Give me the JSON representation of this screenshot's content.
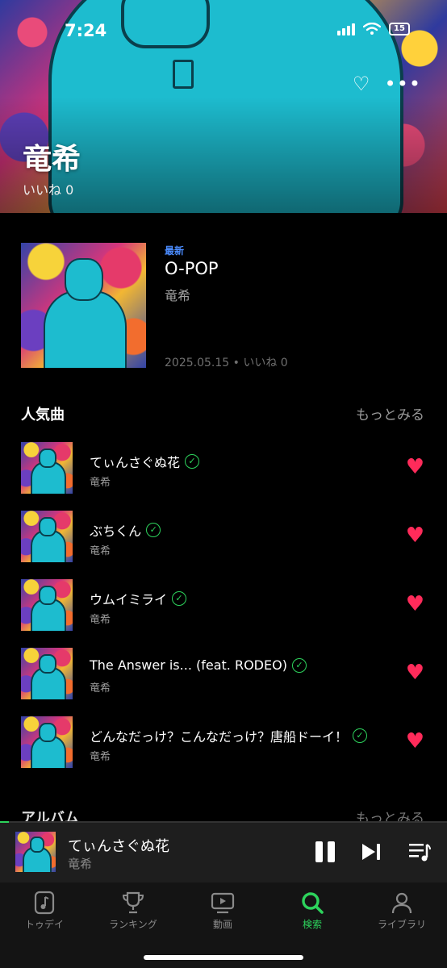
{
  "status_bar": {
    "time": "7:24",
    "battery": "15"
  },
  "artist": {
    "name": "竜希",
    "likes": "いいね 0"
  },
  "latest": {
    "tag": "最新",
    "title": "O-POP",
    "artist": "竜希",
    "meta": "2025.05.15 • いいね 0"
  },
  "popular": {
    "title": "人気曲",
    "more": "もっとみる",
    "tracks": [
      {
        "title": "てぃんさぐぬ花",
        "artist": "竜希"
      },
      {
        "title": "ぶちくん",
        "artist": "竜希"
      },
      {
        "title": "ウムイミライ",
        "artist": "竜希"
      },
      {
        "title": "The Answer is... (feat. RODEO)",
        "artist": "竜希"
      },
      {
        "title": "どんなだっけ？こんなだっけ？唐船ドーイ！",
        "artist": "竜希"
      }
    ]
  },
  "albums": {
    "title": "アルバム",
    "more": "もっとみる"
  },
  "player": {
    "title": "てぃんさぐぬ花",
    "artist": "竜希",
    "progress": 0.02
  },
  "tabs": [
    {
      "label": "トゥデイ",
      "icon": "music-note-icon"
    },
    {
      "label": "ランキング",
      "icon": "trophy-icon"
    },
    {
      "label": "動画",
      "icon": "video-icon"
    },
    {
      "label": "検索",
      "icon": "search-icon",
      "active": true
    },
    {
      "label": "ライブラリ",
      "icon": "person-icon"
    }
  ],
  "colors": {
    "accent": "#2dd35c",
    "like": "#ff2b5a",
    "tag": "#4b8cff"
  }
}
